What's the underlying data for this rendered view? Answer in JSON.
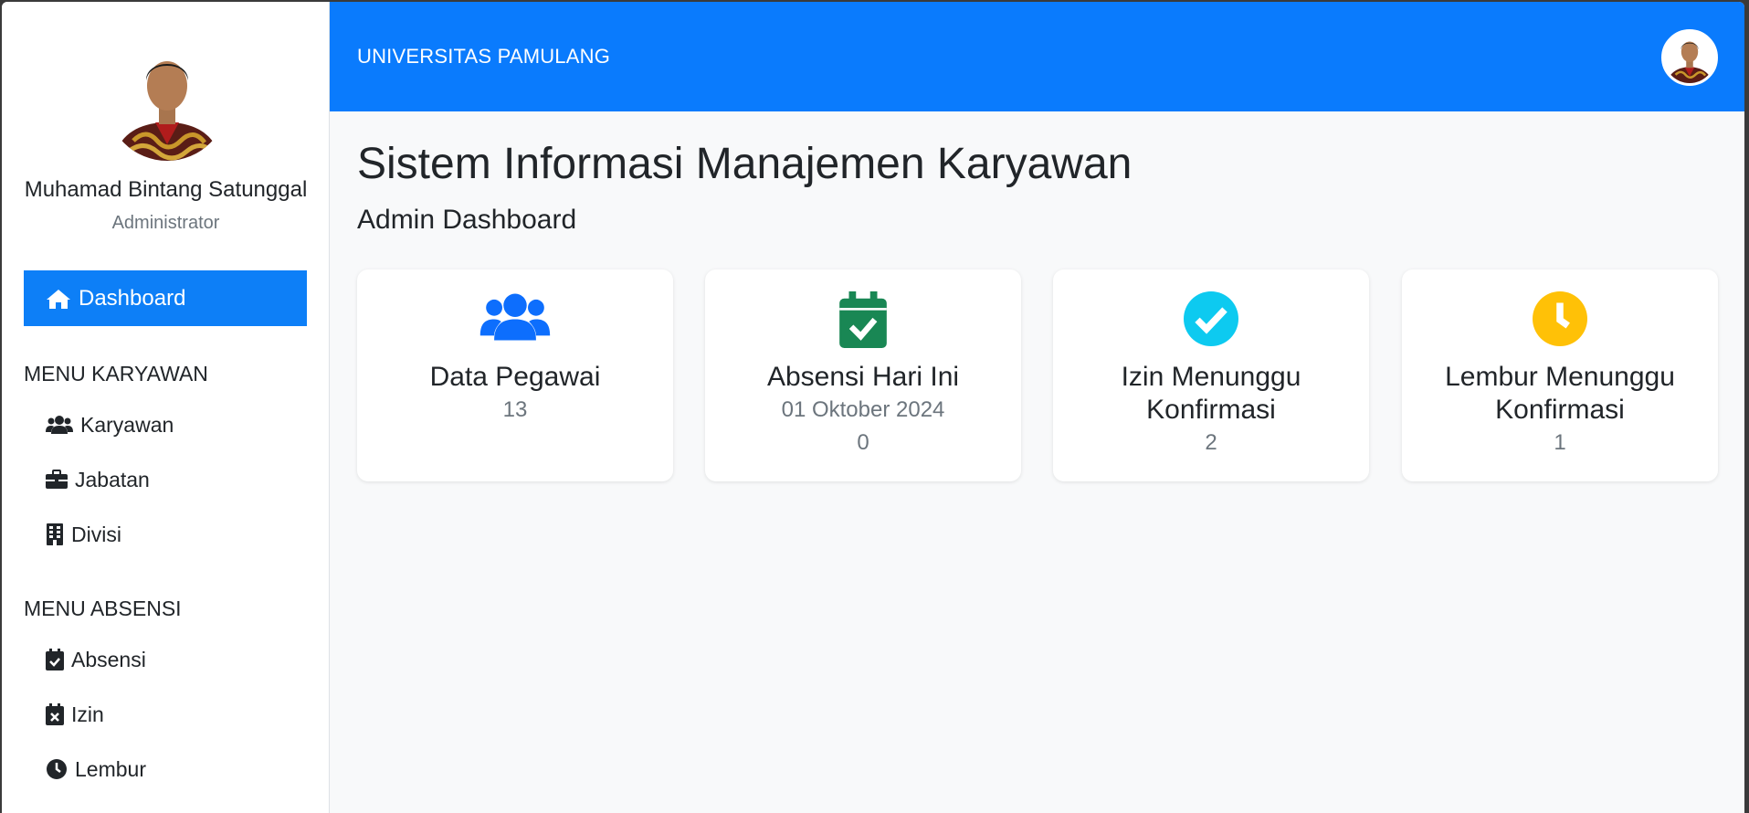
{
  "profile": {
    "name": "Muhamad Bintang Satunggal",
    "role": "Administrator"
  },
  "sidebar": {
    "active": {
      "label": "Dashboard",
      "icon": "home-icon"
    },
    "sections": [
      {
        "title": "MENU KARYAWAN",
        "items": [
          {
            "label": "Karyawan",
            "icon": "users-icon"
          },
          {
            "label": "Jabatan",
            "icon": "briefcase-icon"
          },
          {
            "label": "Divisi",
            "icon": "building-icon"
          }
        ]
      },
      {
        "title": "MENU ABSENSI",
        "items": [
          {
            "label": "Absensi",
            "icon": "calendar-check-icon"
          },
          {
            "label": "Izin",
            "icon": "calendar-x-icon"
          },
          {
            "label": "Lembur",
            "icon": "clock-icon"
          }
        ]
      }
    ]
  },
  "header": {
    "brand": "UNIVERSITAS PAMULANG"
  },
  "main": {
    "title": "Sistem Informasi Manajemen Karyawan",
    "subtitle": "Admin Dashboard",
    "cards": [
      {
        "title": "Data Pegawai",
        "value": "13",
        "icon": "users-icon",
        "color": "#0d6efd"
      },
      {
        "title": "Absensi Hari Ini",
        "date": "01 Oktober 2024",
        "value": "0",
        "icon": "calendar-check-icon",
        "color": "#198754"
      },
      {
        "title_line1": "Izin Menunggu",
        "title_line2": "Konfirmasi",
        "value": "2",
        "icon": "check-circle-icon",
        "color": "#0dcaf0"
      },
      {
        "title_line1": "Lembur Menunggu",
        "title_line2": "Konfirmasi",
        "value": "1",
        "icon": "clock-icon",
        "color": "#ffc107"
      }
    ]
  },
  "colors": {
    "primary": "#0a7bfd",
    "active_nav": "#0d7ff7",
    "background": "#f8f9fa"
  }
}
